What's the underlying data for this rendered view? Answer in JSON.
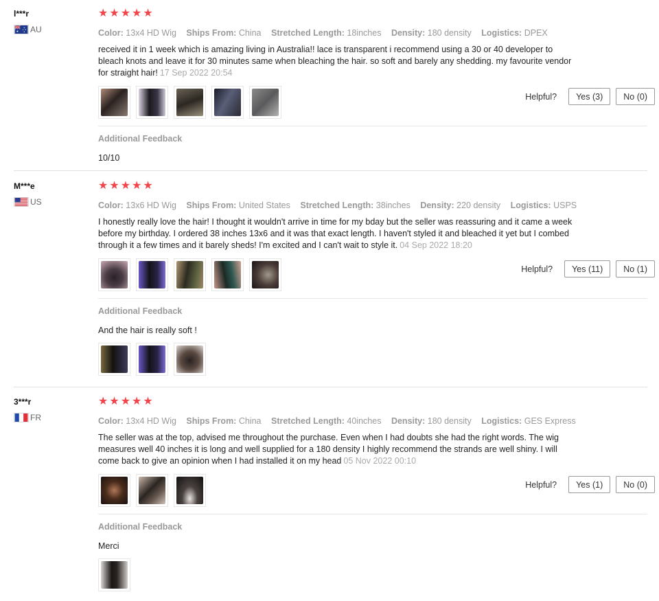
{
  "helpful_label": "Helpful?",
  "additional_feedback_title": "Additional Feedback",
  "reviews": [
    {
      "user": "l***r",
      "country": "AU",
      "flag_icon": "australia-flag-icon",
      "rating": 5,
      "attributes": {
        "color_label": "Color:",
        "color": "13x4 HD Wig",
        "ships_label": "Ships From:",
        "ships": "China",
        "length_label": "Stretched Length:",
        "length": "18inches",
        "density_label": "Density:",
        "density": "180 density",
        "logistics_label": "Logistics:",
        "logistics": "DPEX"
      },
      "text": "received it in 1 week which is amazing living in Australia!! lace is transparent i recommend using a 30 or 40 developer to bleach knots and leave it for 30 minutes same when bleaching the hair. so soft and barely any shedding. my favourite vendor for straight hair!",
      "date": "17 Sep 2022 20:54",
      "photos": 5,
      "yes_label": "Yes (3)",
      "no_label": "No (0)",
      "additional_text": "10/10",
      "additional_photos": 0
    },
    {
      "user": "M***e",
      "country": "US",
      "flag_icon": "us-flag-icon",
      "rating": 5,
      "attributes": {
        "color_label": "Color:",
        "color": "13x6 HD Wig",
        "ships_label": "Ships From:",
        "ships": "United States",
        "length_label": "Stretched Length:",
        "length": "38inches",
        "density_label": "Density:",
        "density": "220 density",
        "logistics_label": "Logistics:",
        "logistics": "USPS"
      },
      "text": "I honestly really love the hair! I thought it wouldn't arrive in time for my bday but the seller was reassuring and it came a week before my birthday. I ordered 38 inches 13x6 and it was that exact length. I haven't styled it and bleached it yet but I combed through it a few times and it barely sheds! I'm excited and I can't wait to style it.",
      "date": "04 Sep 2022 18:20",
      "photos": 5,
      "yes_label": "Yes (11)",
      "no_label": "No (1)",
      "additional_text": "And the hair is really soft !",
      "additional_photos": 3
    },
    {
      "user": "3***r",
      "country": "FR",
      "flag_icon": "france-flag-icon",
      "rating": 5,
      "attributes": {
        "color_label": "Color:",
        "color": "13x4 HD Wig",
        "ships_label": "Ships From:",
        "ships": "China",
        "length_label": "Stretched Length:",
        "length": "40inches",
        "density_label": "Density:",
        "density": "180 density",
        "logistics_label": "Logistics:",
        "logistics": "GES Express"
      },
      "text": "The seller was at the top, advised me throughout the purchase. Even when I had doubts she had the right words. The wig measures well 40 inches it is long and well supplied for a 180 density I highly recommend the strands are well shiny. I will come back to give an opinion when I had installed it on my head",
      "date": "05 Nov 2022 00:10",
      "photos": 3,
      "yes_label": "Yes (1)",
      "no_label": "No (0)",
      "additional_text": "Merci",
      "additional_photos": 1
    }
  ]
}
